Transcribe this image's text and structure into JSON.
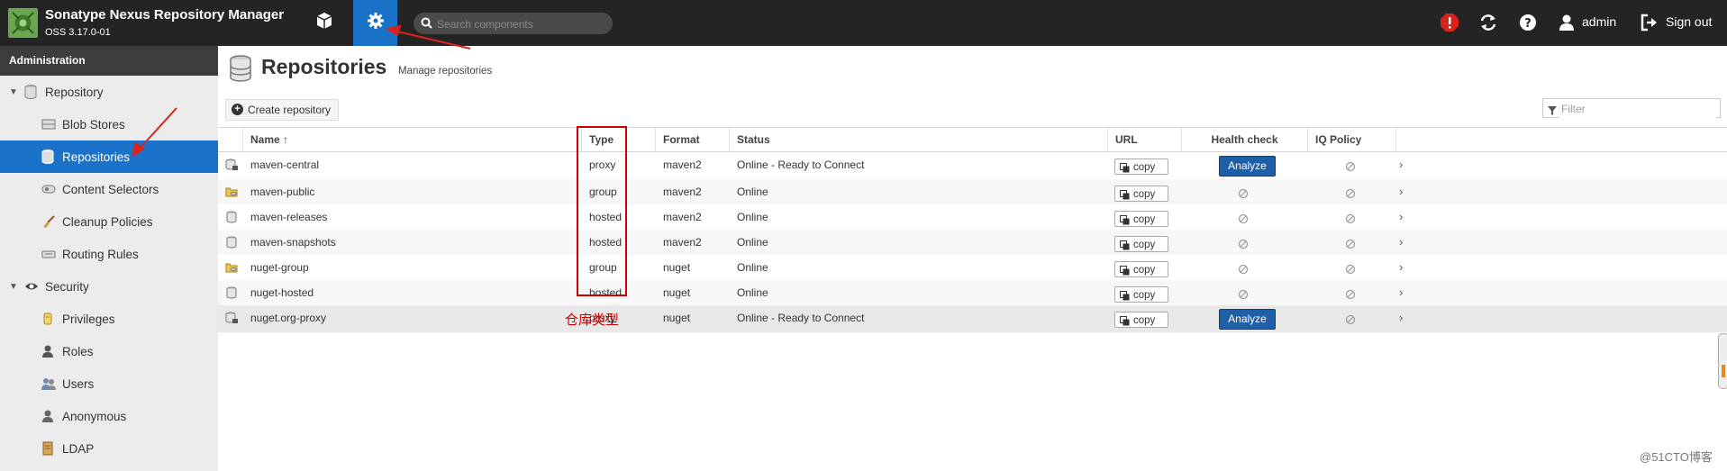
{
  "header": {
    "app_title": "Sonatype Nexus Repository Manager",
    "app_version": "OSS 3.17.0-01",
    "search_placeholder": "Search components",
    "user_name": "admin",
    "sign_out_label": "Sign out",
    "accent_color": "#1a73c8",
    "alert_color": "#d9241c"
  },
  "sidebar": {
    "section_title": "Administration",
    "groups": [
      {
        "label": "Repository",
        "icon": "database-icon",
        "items": [
          {
            "label": "Blob Stores",
            "icon": "blob-store-icon",
            "active": false
          },
          {
            "label": "Repositories",
            "icon": "database-icon",
            "active": true
          },
          {
            "label": "Content Selectors",
            "icon": "content-selector-icon",
            "active": false
          },
          {
            "label": "Cleanup Policies",
            "icon": "broom-icon",
            "active": false
          },
          {
            "label": "Routing Rules",
            "icon": "routing-icon",
            "active": false
          }
        ]
      },
      {
        "label": "Security",
        "icon": "eye-icon",
        "items": [
          {
            "label": "Privileges",
            "icon": "privilege-icon",
            "active": false
          },
          {
            "label": "Roles",
            "icon": "role-icon",
            "active": false
          },
          {
            "label": "Users",
            "icon": "users-icon",
            "active": false
          },
          {
            "label": "Anonymous",
            "icon": "anonymous-icon",
            "active": false
          },
          {
            "label": "LDAP",
            "icon": "ldap-icon",
            "active": false
          }
        ]
      }
    ]
  },
  "main": {
    "title": "Repositories",
    "subtitle": "Manage repositories",
    "create_label": "Create repository",
    "filter_placeholder": "Filter",
    "columns": [
      "Name ↑",
      "Type",
      "Format",
      "Status",
      "URL",
      "Health check",
      "IQ Policy Viola..."
    ],
    "copy_label": "copy",
    "analyze_label": "Analyze",
    "rows": [
      {
        "name": "maven-central",
        "type": "proxy",
        "format": "maven2",
        "status": "Online - Ready to Connect",
        "icon": "proxy-repo-icon",
        "health": "Analyze"
      },
      {
        "name": "maven-public",
        "type": "group",
        "format": "maven2",
        "status": "Online",
        "icon": "group-repo-icon",
        "health": ""
      },
      {
        "name": "maven-releases",
        "type": "hosted",
        "format": "maven2",
        "status": "Online",
        "icon": "hosted-repo-icon",
        "health": ""
      },
      {
        "name": "maven-snapshots",
        "type": "hosted",
        "format": "maven2",
        "status": "Online",
        "icon": "hosted-repo-icon",
        "health": ""
      },
      {
        "name": "nuget-group",
        "type": "group",
        "format": "nuget",
        "status": "Online",
        "icon": "group-repo-icon",
        "health": ""
      },
      {
        "name": "nuget-hosted",
        "type": "hosted",
        "format": "nuget",
        "status": "Online",
        "icon": "hosted-repo-icon",
        "health": ""
      },
      {
        "name": "nuget.org-proxy",
        "type": "proxy",
        "format": "nuget",
        "status": "Online - Ready to Connect",
        "icon": "proxy-repo-icon",
        "health": "Analyze"
      }
    ]
  },
  "annotation": {
    "label": "仓库类型",
    "color": "#cc0000"
  },
  "watermark": "@51CTO博客"
}
